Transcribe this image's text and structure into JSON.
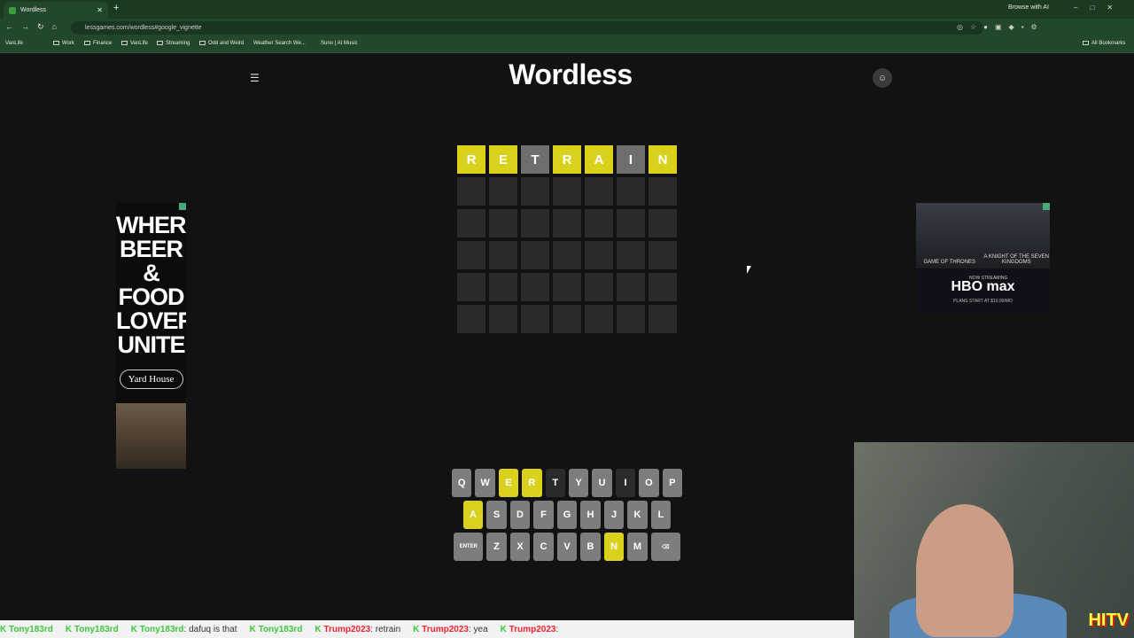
{
  "browser": {
    "tab_title": "Wordless",
    "url": "lessgames.com/wordless#google_vignette",
    "browse_ai": "Browse with AI",
    "bookmarks": [
      "VanLife",
      "Work",
      "Finance",
      "VanLife",
      "Streaming",
      "Odd and Weird",
      "Weather Search We...",
      "Suno | AI Music"
    ],
    "all_bookmarks": "All Bookmarks"
  },
  "game": {
    "title": "Wordless",
    "rows": [
      [
        {
          "l": "R",
          "s": "y"
        },
        {
          "l": "E",
          "s": "y"
        },
        {
          "l": "T",
          "s": "g"
        },
        {
          "l": "R",
          "s": "y"
        },
        {
          "l": "A",
          "s": "y"
        },
        {
          "l": "I",
          "s": "g"
        },
        {
          "l": "N",
          "s": "y"
        }
      ],
      [
        {
          "l": "",
          "s": ""
        },
        {
          "l": "",
          "s": ""
        },
        {
          "l": "",
          "s": ""
        },
        {
          "l": "",
          "s": ""
        },
        {
          "l": "",
          "s": ""
        },
        {
          "l": "",
          "s": ""
        },
        {
          "l": "",
          "s": ""
        }
      ],
      [
        {
          "l": "",
          "s": ""
        },
        {
          "l": "",
          "s": ""
        },
        {
          "l": "",
          "s": ""
        },
        {
          "l": "",
          "s": ""
        },
        {
          "l": "",
          "s": ""
        },
        {
          "l": "",
          "s": ""
        },
        {
          "l": "",
          "s": ""
        }
      ],
      [
        {
          "l": "",
          "s": ""
        },
        {
          "l": "",
          "s": ""
        },
        {
          "l": "",
          "s": ""
        },
        {
          "l": "",
          "s": ""
        },
        {
          "l": "",
          "s": ""
        },
        {
          "l": "",
          "s": ""
        },
        {
          "l": "",
          "s": ""
        }
      ],
      [
        {
          "l": "",
          "s": ""
        },
        {
          "l": "",
          "s": ""
        },
        {
          "l": "",
          "s": ""
        },
        {
          "l": "",
          "s": ""
        },
        {
          "l": "",
          "s": ""
        },
        {
          "l": "",
          "s": ""
        },
        {
          "l": "",
          "s": ""
        }
      ],
      [
        {
          "l": "",
          "s": ""
        },
        {
          "l": "",
          "s": ""
        },
        {
          "l": "",
          "s": ""
        },
        {
          "l": "",
          "s": ""
        },
        {
          "l": "",
          "s": ""
        },
        {
          "l": "",
          "s": ""
        },
        {
          "l": "",
          "s": ""
        }
      ]
    ],
    "keyboard": [
      [
        {
          "k": "Q"
        },
        {
          "k": "W"
        },
        {
          "k": "E",
          "s": "y"
        },
        {
          "k": "R",
          "s": "y"
        },
        {
          "k": "T",
          "s": "d"
        },
        {
          "k": "Y"
        },
        {
          "k": "U"
        },
        {
          "k": "I",
          "s": "d"
        },
        {
          "k": "O"
        },
        {
          "k": "P"
        }
      ],
      [
        {
          "k": "A",
          "s": "y"
        },
        {
          "k": "S"
        },
        {
          "k": "D"
        },
        {
          "k": "F"
        },
        {
          "k": "G"
        },
        {
          "k": "H"
        },
        {
          "k": "J"
        },
        {
          "k": "K"
        },
        {
          "k": "L"
        }
      ],
      [
        {
          "k": "ENTER",
          "w": 1
        },
        {
          "k": "Z"
        },
        {
          "k": "X"
        },
        {
          "k": "C"
        },
        {
          "k": "V"
        },
        {
          "k": "B"
        },
        {
          "k": "N",
          "s": "y"
        },
        {
          "k": "M"
        },
        {
          "k": "⌫",
          "w": 1
        }
      ]
    ]
  },
  "ads": {
    "left_text": "WHERE BEER & FOOD LOVERS UNITE",
    "left_logo": "Yard House",
    "right_show1": "GAME OF THRONES",
    "right_show2": "A KNIGHT OF THE SEVEN KINGDOMS",
    "right_now": "NOW STREAMING",
    "right_brand": "HBO max",
    "right_plan": "PLANS START AT $10.99/MO"
  },
  "ticker": [
    {
      "user": "Tony183rd",
      "msg": ""
    },
    {
      "user": "Tony183rd",
      "msg": ""
    },
    {
      "user": "Tony183rd",
      "msg": ": dafuq is that"
    },
    {
      "user": "Tony183rd",
      "msg": ""
    },
    {
      "user": "Trump2023",
      "msg": ": retrain"
    },
    {
      "user": "Trump2023",
      "msg": ": yea"
    },
    {
      "user": "Trump2023",
      "msg": ":"
    }
  ],
  "colors": {
    "present": "#d9d11c",
    "absent": "#6e6e70",
    "empty": "#2b2b2c",
    "background": "#121213"
  }
}
